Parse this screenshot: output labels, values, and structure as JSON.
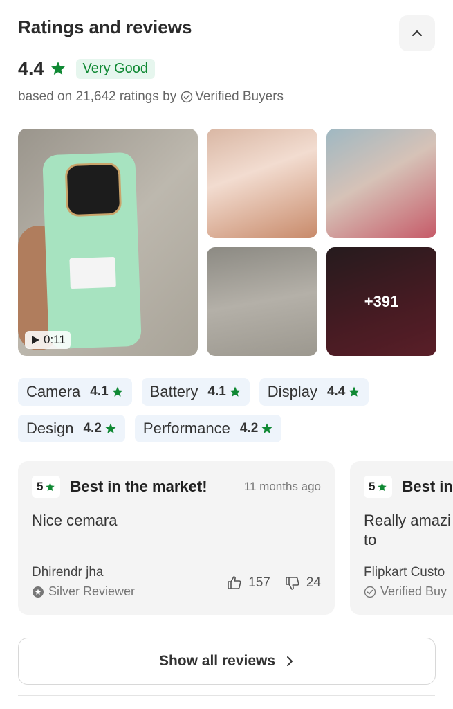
{
  "header": {
    "title": "Ratings and reviews"
  },
  "summary": {
    "rating": "4.4",
    "badge": "Very Good",
    "based_prefix": "based on 21,642 ratings by",
    "verified": "Verified Buyers"
  },
  "media": {
    "video_duration": "0:11",
    "more_count": "+391"
  },
  "aspects": [
    {
      "label": "Camera",
      "value": "4.1"
    },
    {
      "label": "Battery",
      "value": "4.1"
    },
    {
      "label": "Display",
      "value": "4.4"
    },
    {
      "label": "Design",
      "value": "4.2"
    },
    {
      "label": "Performance",
      "value": "4.2"
    }
  ],
  "reviews": [
    {
      "stars": "5",
      "title": "Best in the market!",
      "time": "11 months ago",
      "body": "Nice cemara",
      "user": "Dhirendr  jha",
      "role": "Silver Reviewer",
      "likes": "157",
      "dislikes": "24"
    },
    {
      "stars": "5",
      "title": "Best in",
      "body": "Really amazi is superb to",
      "user": "Flipkart Custo",
      "role": "Verified Buy"
    }
  ],
  "footer": {
    "show_all": "Show all reviews"
  },
  "colors": {
    "accent_green": "#108934",
    "badge_bg": "#e6f6ee",
    "chip_bg": "#eef4fb",
    "card_bg": "#f4f4f4"
  }
}
